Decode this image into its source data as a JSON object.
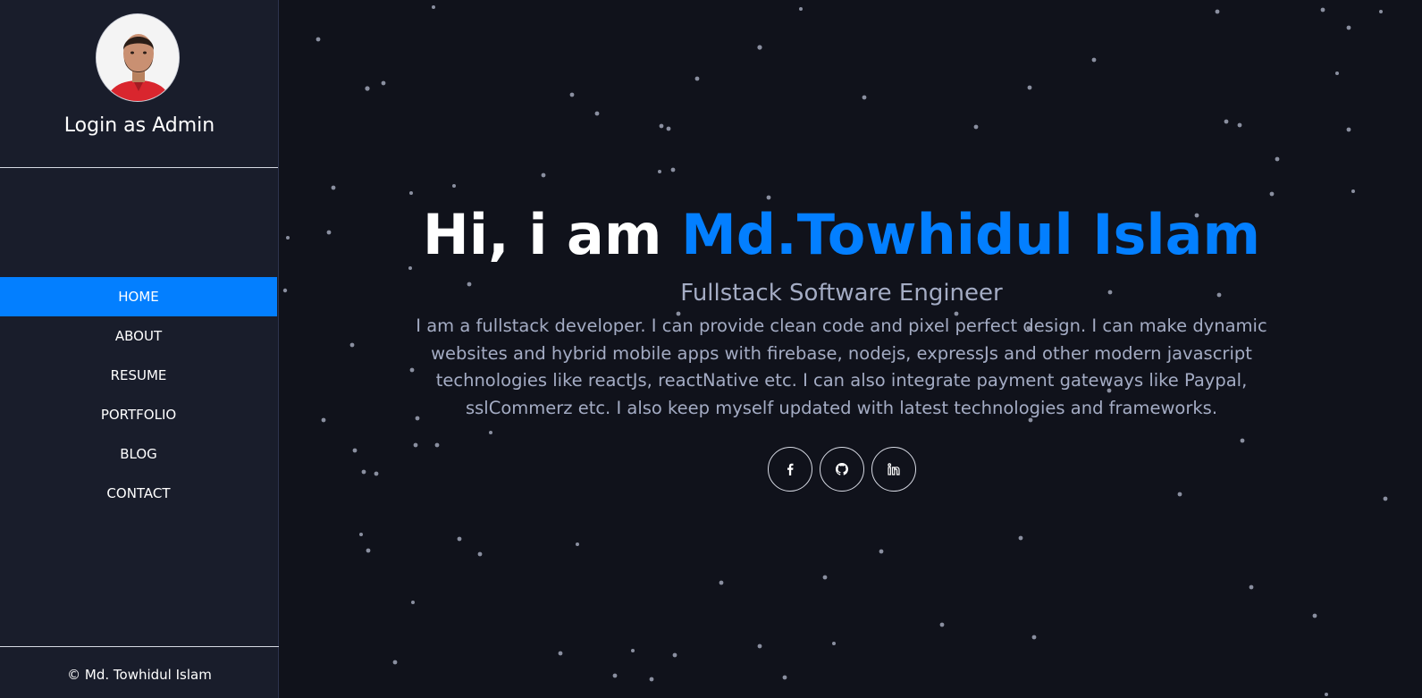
{
  "sidebar": {
    "admin_link": "Login as Admin",
    "nav": [
      {
        "label": "HOME",
        "active": true
      },
      {
        "label": "ABOUT",
        "active": false
      },
      {
        "label": "RESUME",
        "active": false
      },
      {
        "label": "PORTFOLIO",
        "active": false
      },
      {
        "label": "BLOG",
        "active": false
      },
      {
        "label": "CONTACT",
        "active": false
      }
    ],
    "footer": "© Md. Towhidul Islam"
  },
  "hero": {
    "greeting": "Hi, i am ",
    "name": "Md.Towhidul Islam",
    "role": "Fullstack Software Engineer",
    "bio": "I am a fullstack developer. I can provide clean code and pixel perfect design. I can make dynamic websites and hybrid mobile apps with firebase, nodejs, expressJs and other modern javascript technologies like reactJs, reactNative etc. I can also integrate payment gateways like Paypal, sslCommerz etc. I also keep myself updated with latest technologies and frameworks."
  },
  "socials": [
    {
      "icon": "facebook-icon"
    },
    {
      "icon": "github-icon"
    },
    {
      "icon": "linkedin-icon"
    }
  ],
  "colors": {
    "accent": "#037fff",
    "sidebar_bg": "#191d2b",
    "main_bg": "#10121b",
    "muted_text": "#a4acc4"
  }
}
